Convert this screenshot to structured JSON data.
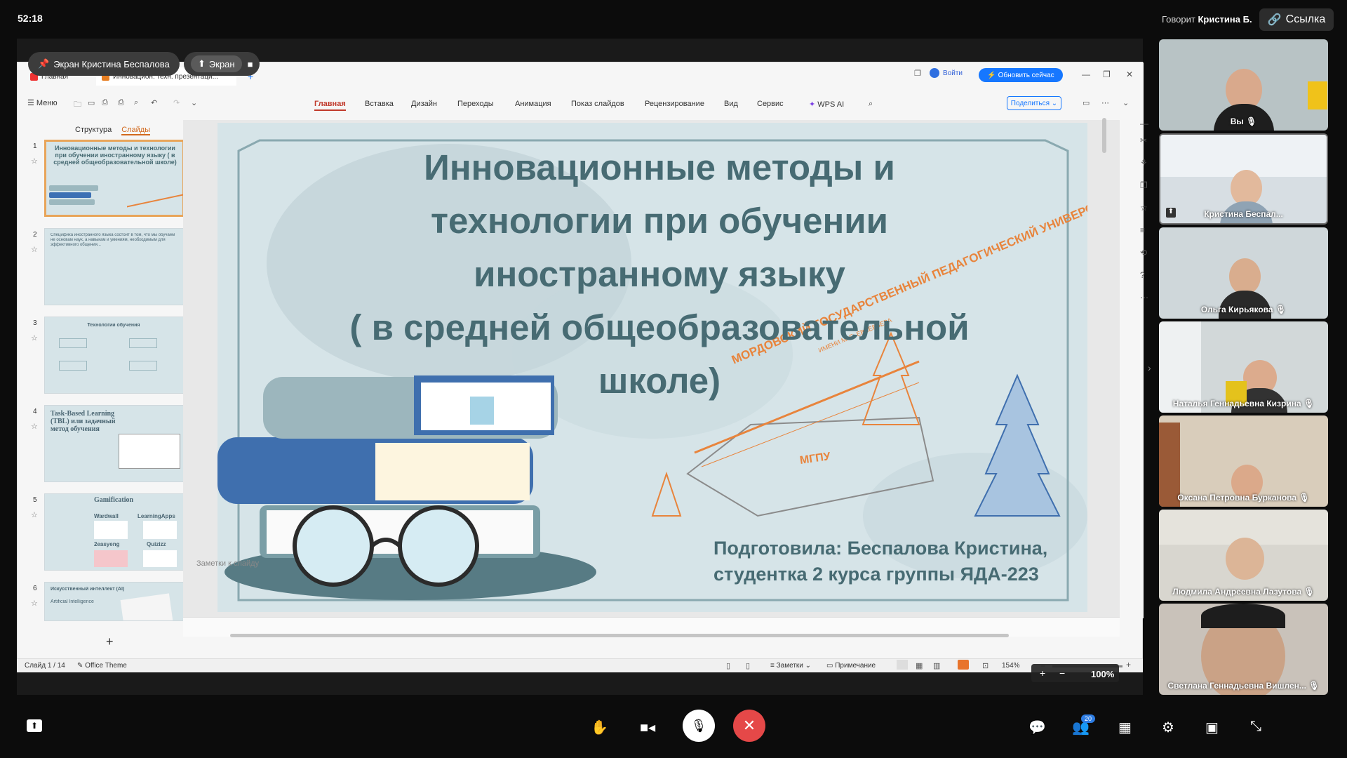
{
  "top": {
    "time": "52:18",
    "speaker_prefix": "Говорит ",
    "speaker_name": "Кристина Б.",
    "link_label": "Ссылка"
  },
  "share": {
    "label": "Экран Кристина Беспалова",
    "screen_label": "Экран"
  },
  "wps": {
    "tabs": [
      {
        "label": "Главная"
      },
      {
        "label": "Инновацион. техн. презентаци..."
      }
    ],
    "login_label": "Войти",
    "update_label": "Обновить сейчас",
    "menu_label": "Меню",
    "ribbon_tabs": [
      "Главная",
      "Вставка",
      "Дизайн",
      "Переходы",
      "Анимация",
      "Показ слайдов",
      "Рецензирование",
      "Вид",
      "Сервис",
      "WPS AI"
    ],
    "share_button": "Поделиться",
    "panel_tabs": [
      "Структура",
      "Слайды"
    ],
    "notes_placeholder": "Заметки к слайду",
    "status": {
      "slide_counter": "Слайд 1 / 14",
      "theme": "Office Theme",
      "notes": "Заметки",
      "comment": "Примечание",
      "zoom": "154%",
      "zoom_overlay": "100%"
    },
    "thumbnails": [
      {
        "num": "1",
        "text": "Инновационные методы и технологии при обучении иностранному языку ( в средней общеобразовательной школе)"
      },
      {
        "num": "2",
        "text": "Специфика иностранного языка состоит в том, что мы обучаем не основам наук, а навыкам и умениям, необходимым для эффективного общения..."
      },
      {
        "num": "3",
        "text": "Технологии обучения"
      },
      {
        "num": "4",
        "text": "Task-Based Learning (TBL) или задачный метод обучения"
      },
      {
        "num": "5",
        "text": "Gamification"
      },
      {
        "num": "6",
        "text": "Искусственный интеллект (AI)"
      }
    ],
    "thumb_sub": {
      "t5_items": [
        "Wardwall",
        "LearningApps",
        "2easyeng",
        "Quizizz"
      ],
      "t6_sub": "Artificial Intelligence"
    }
  },
  "slide": {
    "title_lines": [
      "Инновационные методы и",
      "технологии при обучении",
      "иностранному языку",
      "( в средней общеобразовательной",
      "школе)"
    ],
    "author_line1": "Подготовила: Беспалова Кристина,",
    "author_line2": "студентка 2 курса группы ЯДА-223",
    "logo_text": "МОРДОВСКИЙ ГОСУДАРСТВЕННЫЙ ПЕДАГОГИЧЕСКИЙ УНИВЕРСИТЕТ",
    "logo_sub": "ИМЕНИ М. Е. ЕВСЕВЬЕВА",
    "logo_abbr": "МГПУ"
  },
  "participants": [
    {
      "name": "Вы"
    },
    {
      "name": "Кристина Беспал..."
    },
    {
      "name": "Ольга Кирьякова"
    },
    {
      "name": "Наталья Геннадьевна Кизрина"
    },
    {
      "name": "Оксана Петровна Бурканова"
    },
    {
      "name": "Людмила Андреевна Лазутова"
    },
    {
      "name": "Светлана Геннадьевна Вишлен..."
    }
  ],
  "bottom": {
    "participants_count": "20"
  },
  "colors": {
    "accent": "#1677ff",
    "hangup": "#e54848",
    "slide_bg": "#d6e4e8",
    "title": "#476b73"
  }
}
